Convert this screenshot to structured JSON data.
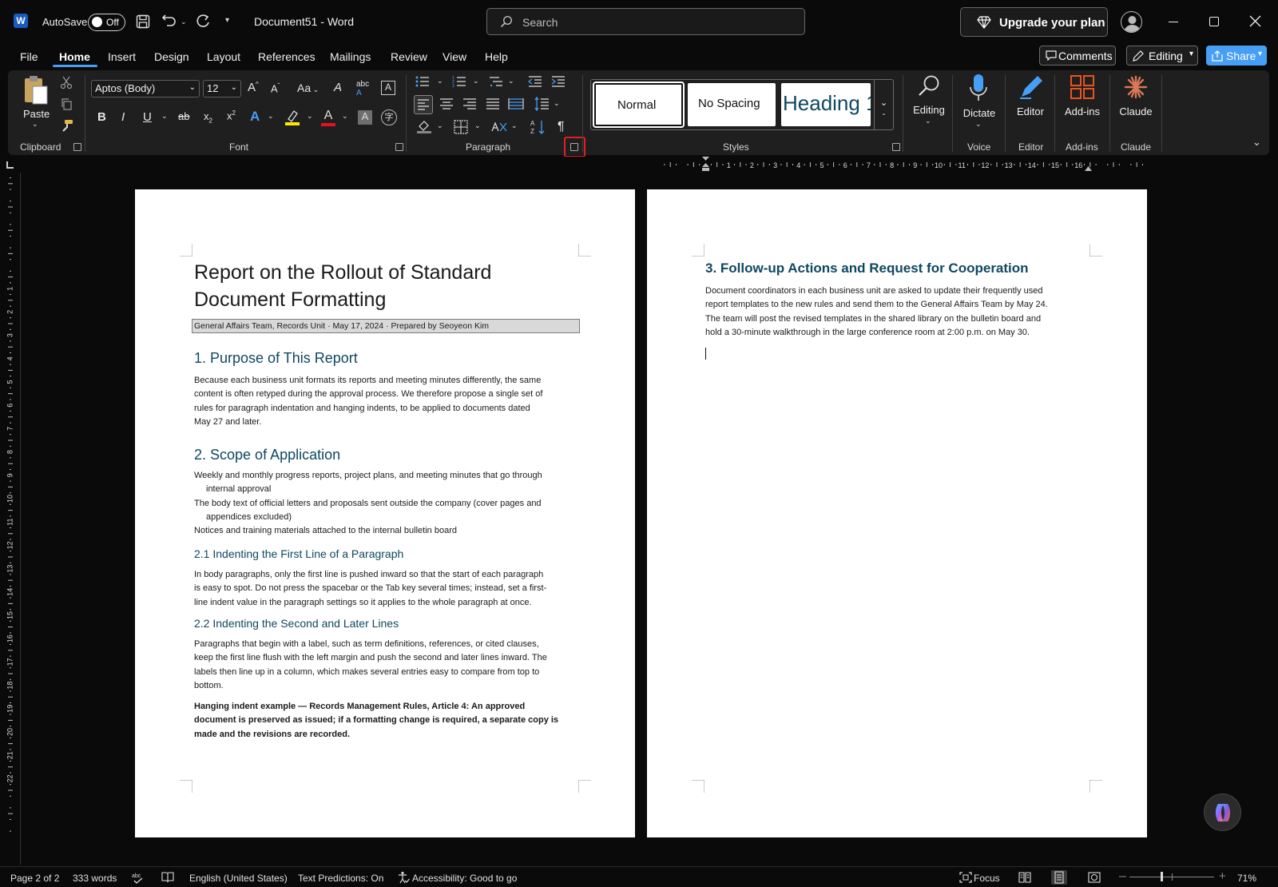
{
  "titlebar": {
    "autosave_label": "AutoSave",
    "autosave_state": "Off",
    "doc_name": "Document51",
    "app_sep": "-",
    "app_name": "Word",
    "search_placeholder": "Search",
    "upgrade_label": "Upgrade your plan"
  },
  "menu": {
    "items": [
      "File",
      "Home",
      "Insert",
      "Design",
      "Layout",
      "References",
      "Mailings",
      "Review",
      "View",
      "Help"
    ],
    "comments_label": "Comments",
    "editing_label": "Editing",
    "share_label": "Share"
  },
  "ribbon": {
    "clipboard": {
      "paste_label": "Paste",
      "group_label": "Clipboard"
    },
    "font": {
      "font_name": "Aptos (Body)",
      "font_size": "12",
      "group_label": "Font"
    },
    "paragraph": {
      "group_label": "Paragraph"
    },
    "styles": {
      "items": [
        "Normal",
        "No Spacing",
        "Heading 1"
      ],
      "group_label": "Styles"
    },
    "editing": {
      "label": "Editing"
    },
    "voice": {
      "dictate_label": "Dictate",
      "group_label": "Voice"
    },
    "editor": {
      "label": "Editor",
      "group_label": "Editor"
    },
    "addins": {
      "label": "Add-ins",
      "group_label": "Add-ins"
    },
    "claude": {
      "label": "Claude",
      "group_label": "Claude"
    }
  },
  "ruler": {
    "h_ticks": [
      "1",
      "2",
      "3",
      "4",
      "5",
      "6",
      "7",
      "8",
      "9",
      "10",
      "11",
      "12",
      "13",
      "14",
      "15",
      "16"
    ],
    "v_ticks": [
      "1",
      "2",
      "3",
      "4",
      "5",
      "6",
      "7",
      "8",
      "9",
      "10",
      "11",
      "12",
      "13",
      "14",
      "15",
      "16",
      "17",
      "18",
      "19",
      "20",
      "21",
      "22"
    ]
  },
  "page1": {
    "title_line1": "Report on the Rollout of Standard",
    "title_line2": "Document Formatting",
    "subtitle": "General Affairs Team, Records Unit · May 17, 2024 · Prepared by Seoyeon Kim",
    "h1_purpose": "1. Purpose of This Report",
    "purpose_lines": [
      "Because each business unit formats its reports and meeting minutes differently, the same",
      "content is often retyped during the approval process. We therefore propose a single set of",
      "rules for paragraph indentation and hanging indents, to be applied to documents dated",
      "May 27 and later."
    ],
    "h1_scope": "2. Scope of Application",
    "scope_items": [
      [
        "Weekly and monthly progress reports, project plans, and meeting minutes that go through",
        "internal approval"
      ],
      [
        "The body text of official letters and proposals sent outside the company (cover pages and",
        "appendices excluded)"
      ],
      [
        "Notices and training materials attached to the internal bulletin board"
      ]
    ],
    "h2_first": "2.1 Indenting the First Line of a Paragraph",
    "first_lines": [
      "In body paragraphs, only the first line is pushed inward so that the start of each paragraph",
      "is easy to spot. Do not press the spacebar or the Tab key several times; instead, set a first-",
      "line indent value in the paragraph settings so it applies to the whole paragraph at once."
    ],
    "h2_second": "2.2 Indenting the Second and Later Lines",
    "second_lines": [
      "Paragraphs that begin with a label, such as term definitions, references, or cited clauses,",
      "keep the first line flush with the left margin and push the second and later lines inward. The",
      "labels then line up in a column, which makes several entries easy to compare from top to",
      "bottom."
    ],
    "example_lines": [
      "Hanging indent example — Records Management Rules, Article 4: An approved",
      "document is preserved as issued; if a formatting change is required, a separate copy is",
      "made and the revisions are recorded."
    ]
  },
  "page2": {
    "h1_followup": "3. Follow-up Actions and Request for Cooperation",
    "followup_lines": [
      "Document coordinators in each business unit are asked to update their frequently used",
      "report templates to the new rules and send them to the General Affairs Team by May 24.",
      "The team will post the revised templates in the shared library on the bulletin board and",
      "hold a 30-minute walkthrough in the large conference room at 2:00 p.m. on May 30."
    ]
  },
  "status": {
    "page": "Page 2 of 2",
    "words": "333 words",
    "language": "English (United States)",
    "predictions": "Text Predictions: On",
    "accessibility": "Accessibility: Good to go",
    "focus": "Focus",
    "zoom": "71%"
  },
  "colors": {
    "accent": "#479ef5",
    "heading": "#0f4761",
    "highlight_box": "#e02020"
  }
}
